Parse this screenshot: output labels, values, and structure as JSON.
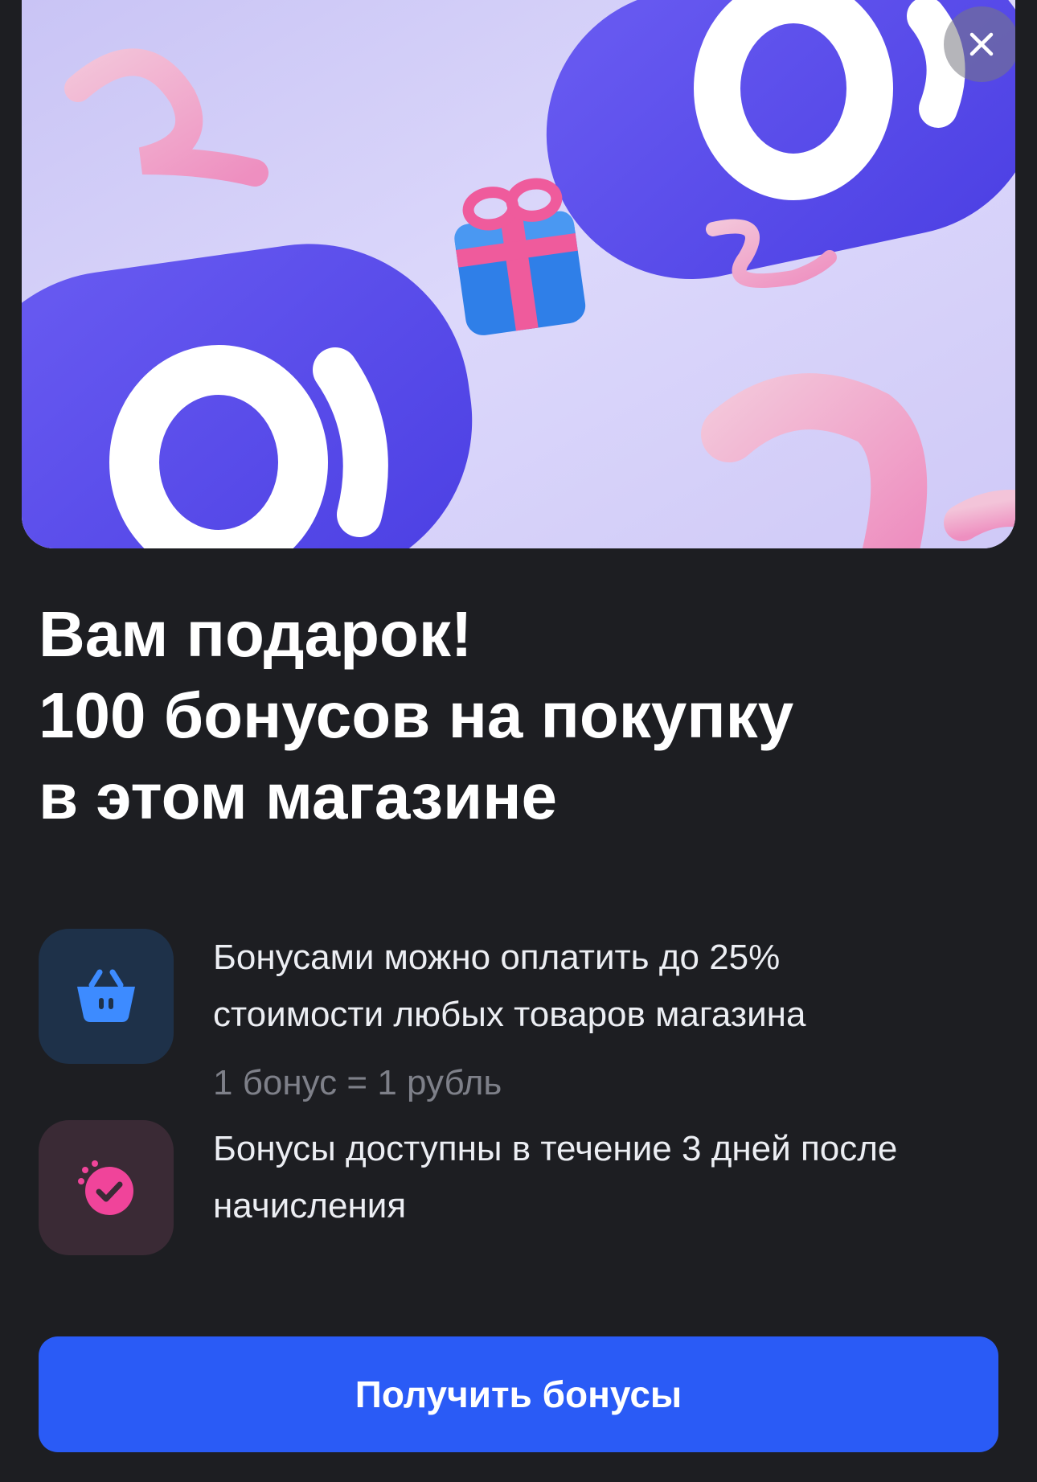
{
  "banner": {
    "close_icon": "close-icon",
    "illustration": "bonus-gift-illustration"
  },
  "title": {
    "line1": "Вам подарок!",
    "line2": "100 бонусов на покупку",
    "line3": "в этом магазине"
  },
  "features": [
    {
      "icon": "basket-icon",
      "line1": "Бонусами можно оплатить до 25%",
      "line2": "стоимости любых товаров магазина",
      "note": "1 бонус = 1 рубль"
    },
    {
      "icon": "timer-check-icon",
      "line1": "Бонусы доступны в течение 3 дней после",
      "line2": "начисления"
    }
  ],
  "cta": {
    "label": "Получить бонусы"
  },
  "colors": {
    "background": "#1d1e22",
    "accent": "#2a5bf6",
    "basket_icon": "#3d8bff",
    "timer_icon": "#f0449a"
  }
}
